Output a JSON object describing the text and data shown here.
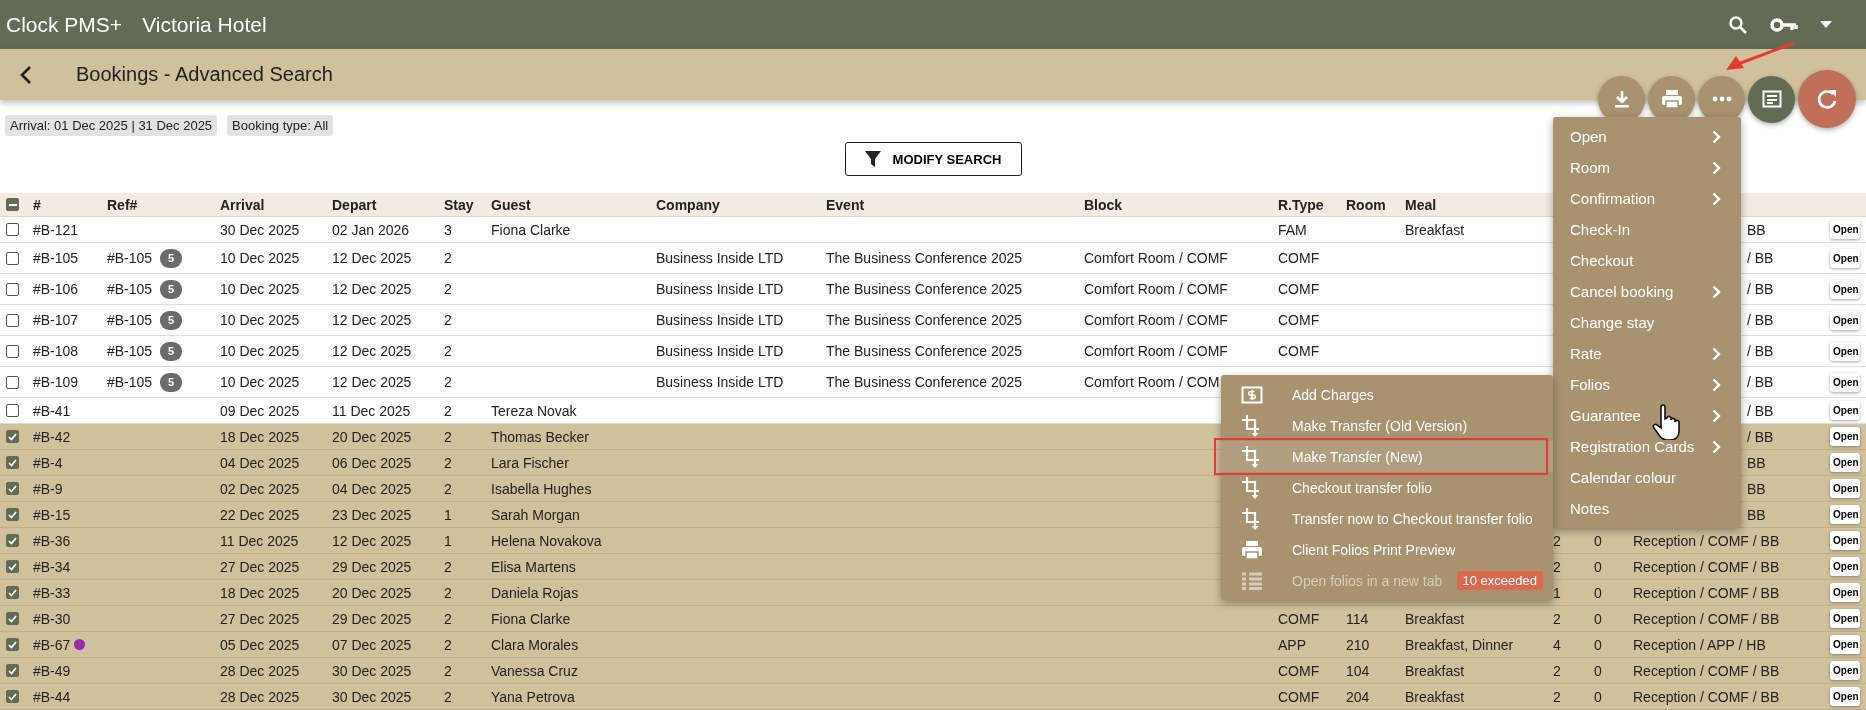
{
  "top_bar": {
    "app_name": "Clock PMS+",
    "hotel": "Victoria Hotel"
  },
  "page": {
    "title": "Bookings - Advanced Search"
  },
  "action_buttons": [
    {
      "kind": "download"
    },
    {
      "kind": "print"
    },
    {
      "kind": "more"
    },
    {
      "kind": "notes"
    },
    {
      "kind": "refresh"
    }
  ],
  "filters": [
    "Arrival: 01 Dec 2025 | 31 Dec 2025",
    "Booking type: All"
  ],
  "modify_button": "MODIFY SEARCH",
  "table": {
    "header_checkbox": {
      "indeterminate": true
    },
    "columns": [
      "#",
      "Ref#",
      "Arrival",
      "Depart",
      "Stay",
      "Guest",
      "Company",
      "Event",
      "Block",
      "R.Type",
      "Room",
      "Meal"
    ],
    "rows": [
      {
        "checked": false,
        "id": "#B-121",
        "arrival": "30 Dec 2025",
        "depart": "02 Jan 2026",
        "stay": "3",
        "guest": "Fiona Clarke",
        "rtype": "FAM",
        "meal": "Breakfast",
        "column_16": "BB",
        "action": "Open"
      },
      {
        "checked": false,
        "id": "#B-105",
        "ref": "#B-105",
        "ref_count": "5",
        "arrival": "10 Dec 2025",
        "depart": "12 Dec 2025",
        "stay": "2",
        "company": "Business Inside LTD",
        "event": "The Business Conference 2025",
        "block": "Comfort Room / COMF",
        "rtype": "COMF",
        "column_16": "/ BB",
        "action": "Open"
      },
      {
        "checked": false,
        "id": "#B-106",
        "ref": "#B-105",
        "ref_count": "5",
        "arrival": "10 Dec 2025",
        "depart": "12 Dec 2025",
        "stay": "2",
        "company": "Business Inside LTD",
        "event": "The Business Conference 2025",
        "block": "Comfort Room / COMF",
        "rtype": "COMF",
        "column_16": "/ BB",
        "action": "Open"
      },
      {
        "checked": false,
        "id": "#B-107",
        "ref": "#B-105",
        "ref_count": "5",
        "arrival": "10 Dec 2025",
        "depart": "12 Dec 2025",
        "stay": "2",
        "company": "Business Inside LTD",
        "event": "The Business Conference 2025",
        "block": "Comfort Room / COMF",
        "rtype": "COMF",
        "column_16": "/ BB",
        "action": "Open"
      },
      {
        "checked": false,
        "id": "#B-108",
        "ref": "#B-105",
        "ref_count": "5",
        "arrival": "10 Dec 2025",
        "depart": "12 Dec 2025",
        "stay": "2",
        "company": "Business Inside LTD",
        "event": "The Business Conference 2025",
        "block": "Comfort Room / COMF",
        "rtype": "COMF",
        "column_16": "/ BB",
        "action": "Open"
      },
      {
        "checked": false,
        "id": "#B-109",
        "ref": "#B-105",
        "ref_count": "5",
        "arrival": "10 Dec 2025",
        "depart": "12 Dec 2025",
        "stay": "2",
        "company": "Business Inside LTD",
        "event": "The Business Conference 2025",
        "block": "Comfort Room / COM",
        "column_16": "/ BB",
        "action": "Open"
      },
      {
        "checked": false,
        "id": "#B-41",
        "arrival": "09 Dec 2025",
        "depart": "11 Dec 2025",
        "stay": "2",
        "guest": "Tereza Novak",
        "column_16": "/ BB",
        "action": "Open"
      },
      {
        "checked": true,
        "id": "#B-42",
        "arrival": "18 Dec 2025",
        "depart": "20 Dec 2025",
        "stay": "2",
        "guest": "Thomas Becker",
        "column_16": "/ BB",
        "action": "Open"
      },
      {
        "checked": true,
        "id": "#B-4",
        "arrival": "04 Dec 2025",
        "depart": "06 Dec 2025",
        "stay": "2",
        "guest": "Lara Fischer",
        "column_16": "BB",
        "action": "Open"
      },
      {
        "checked": true,
        "id": "#B-9",
        "arrival": "02 Dec 2025",
        "depart": "04 Dec 2025",
        "stay": "2",
        "guest": "Isabella Hughes",
        "column_16": "BB",
        "action": "Open"
      },
      {
        "checked": true,
        "id": "#B-15",
        "arrival": "22 Dec 2025",
        "depart": "23 Dec 2025",
        "stay": "1",
        "guest": "Sarah Morgan",
        "column_16": "BB",
        "action": "Open"
      },
      {
        "checked": true,
        "id": "#B-36",
        "arrival": "11 Dec 2025",
        "depart": "12 Dec 2025",
        "stay": "1",
        "guest": "Helena Novakova",
        "column_14": "2",
        "column_15": "0",
        "column_16": "Reception / COMF / BB",
        "action": "Open"
      },
      {
        "checked": true,
        "id": "#B-34",
        "arrival": "27 Dec 2025",
        "depart": "29 Dec 2025",
        "stay": "2",
        "guest": "Elisa Martens",
        "column_14": "2",
        "column_15": "0",
        "column_16": "Reception / COMF / BB",
        "action": "Open"
      },
      {
        "checked": true,
        "id": "#B-33",
        "arrival": "18 Dec 2025",
        "depart": "20 Dec 2025",
        "stay": "2",
        "guest": "Daniela Rojas",
        "column_14": "1",
        "column_15": "0",
        "column_16": "Reception / COMF / BB",
        "action": "Open"
      },
      {
        "checked": true,
        "id": "#B-30",
        "arrival": "27 Dec 2025",
        "depart": "29 Dec 2025",
        "stay": "2",
        "guest": "Fiona Clarke",
        "rtype": "COMF",
        "room": "114",
        "meal": "Breakfast",
        "column_14": "2",
        "column_15": "0",
        "column_16": "Reception / COMF / BB",
        "action": "Open"
      },
      {
        "checked": true,
        "id": "#B-67",
        "color": "#9c27b0",
        "arrival": "05 Dec 2025",
        "depart": "07 Dec 2025",
        "stay": "2",
        "guest": "Clara Morales",
        "rtype": "APP",
        "room": "210",
        "meal": "Breakfast, Dinner",
        "column_14": "4",
        "column_15": "0",
        "column_16": "Reception / APP / HB",
        "action": "Open"
      },
      {
        "checked": true,
        "id": "#B-49",
        "arrival": "28 Dec 2025",
        "depart": "30 Dec 2025",
        "stay": "2",
        "guest": "Vanessa Cruz",
        "rtype": "COMF",
        "room": "104",
        "meal": "Breakfast",
        "column_14": "2",
        "column_15": "0",
        "column_16": "Reception / COMF / BB",
        "action": "Open"
      },
      {
        "checked": true,
        "id": "#B-44",
        "arrival": "28 Dec 2025",
        "depart": "30 Dec 2025",
        "stay": "2",
        "guest": "Yana Petrova",
        "rtype": "COMF",
        "room": "204",
        "meal": "Breakfast",
        "column_14": "2",
        "column_15": "0",
        "column_16": "Reception / COMF / BB",
        "action": "Open"
      }
    ]
  },
  "context_menu": {
    "items": [
      {
        "label": "Open",
        "submenu": true
      },
      {
        "label": "Room",
        "submenu": true
      },
      {
        "label": "Confirmation",
        "submenu": true
      },
      {
        "label": "Check-In",
        "submenu": false
      },
      {
        "label": "Checkout",
        "submenu": false
      },
      {
        "label": "Cancel booking",
        "submenu": true
      },
      {
        "label": "Change stay",
        "submenu": false
      },
      {
        "label": "Rate",
        "submenu": true
      },
      {
        "label": "Folios",
        "submenu": true
      },
      {
        "label": "Guarantee",
        "submenu": true
      },
      {
        "label": "Registration Cards",
        "submenu": true
      },
      {
        "label": "Calendar colour",
        "submenu": false
      },
      {
        "label": "Notes",
        "submenu": false
      }
    ]
  },
  "folios_submenu": {
    "items": [
      {
        "kind": "charges",
        "label": "Add Charges",
        "selected": false,
        "disabled": false,
        "outlined": false
      },
      {
        "kind": "transfer",
        "label": "Make Transfer (Old Version)",
        "selected": false,
        "disabled": false,
        "outlined": false
      },
      {
        "kind": "transfer",
        "label": "Make Transfer (New)",
        "selected": true,
        "disabled": false,
        "outlined": true
      },
      {
        "kind": "transfer",
        "label": "Checkout transfer folio",
        "selected": false,
        "disabled": false,
        "outlined": false
      },
      {
        "kind": "transfer",
        "label": "Transfer now to Checkout transfer folio",
        "selected": false,
        "disabled": false,
        "outlined": false
      },
      {
        "kind": "print",
        "label": "Client Folios Print Preview",
        "selected": false,
        "disabled": false,
        "outlined": false
      },
      {
        "kind": "list",
        "label": "Open folios in a new tab",
        "selected": false,
        "disabled": true,
        "outlined": false,
        "badge": "10 exceeded"
      }
    ]
  }
}
